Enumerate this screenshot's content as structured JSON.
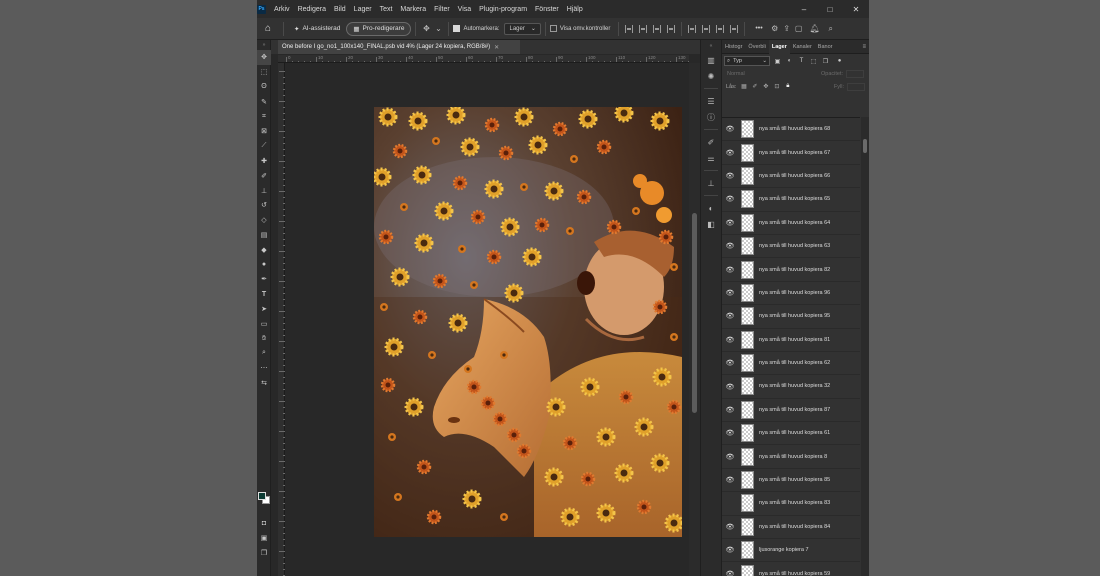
{
  "app": {
    "logo": "Ps",
    "menu": [
      "Arkiv",
      "Redigera",
      "Bild",
      "Lager",
      "Text",
      "Markera",
      "Filter",
      "Visa",
      "Plugin-program",
      "Fönster",
      "Hjälp"
    ],
    "window_controls": [
      "–",
      "□",
      "✕"
    ]
  },
  "options_bar": {
    "ai_label": "AI-assisterad",
    "pro_label": "Pro-redigerare",
    "automarkera_label": "Automarkera:",
    "automarkera_checked": true,
    "select_value": "Lager",
    "visa_label": "Visa omv.kontroller",
    "visa_checked": false,
    "more_icon": "•••"
  },
  "document": {
    "tab_title": "One before I go_no1_100x140_FINAL.psb vid 4% (Lager 24 kopiera, RGB/8#)",
    "ruler_labels": [
      "0",
      "10",
      "20",
      "30",
      "40",
      "50",
      "60",
      "70",
      "80",
      "90",
      "100",
      "110",
      "120",
      "130",
      "140"
    ]
  },
  "colors": {
    "foreground": "#0b3a32",
    "background": "#ffffff",
    "accent": "#31a8ff"
  },
  "panel": {
    "tabs": [
      "Histogr",
      "Överbli",
      "Lager",
      "Kanaler",
      "Banor"
    ],
    "active_tab": "Lager",
    "filter_value": "Typ",
    "blend_mode": "Normal",
    "opacity_label": "Opacitet:",
    "lock_label": "Lås:",
    "fill_label": "Fyll:",
    "layers": [
      {
        "name": "nya små till huvud kopiera 68",
        "visible": true
      },
      {
        "name": "nya små till huvud kopiera 67",
        "visible": true
      },
      {
        "name": "nya små till huvud kopiera 66",
        "visible": true
      },
      {
        "name": "nya små till huvud kopiera 65",
        "visible": true
      },
      {
        "name": "nya små till huvud kopiera 64",
        "visible": true
      },
      {
        "name": "nya små till huvud kopiera 63",
        "visible": true
      },
      {
        "name": "nya små till huvud kopiera 82",
        "visible": true
      },
      {
        "name": "nya små till huvud kopiera 96",
        "visible": true
      },
      {
        "name": "nya små till huvud kopiera 95",
        "visible": true
      },
      {
        "name": "nya små till huvud kopiera 81",
        "visible": true
      },
      {
        "name": "nya små till huvud kopiera 62",
        "visible": true
      },
      {
        "name": "nya små till huvud kopiera 32",
        "visible": true
      },
      {
        "name": "nya små till huvud kopiera 87",
        "visible": true
      },
      {
        "name": "nya små till huvud kopiera 61",
        "visible": true
      },
      {
        "name": "nya små till huvud kopiera 8",
        "visible": true
      },
      {
        "name": "nya små till huvud kopiera 85",
        "visible": true
      },
      {
        "name": "nya små till huvud kopiera 83",
        "visible": false
      },
      {
        "name": "nya små till huvud kopiera 84",
        "visible": true
      },
      {
        "name": "ljusorange kopiera 7",
        "visible": true
      },
      {
        "name": "nya små till huvud kopiera 59",
        "visible": true
      }
    ]
  }
}
